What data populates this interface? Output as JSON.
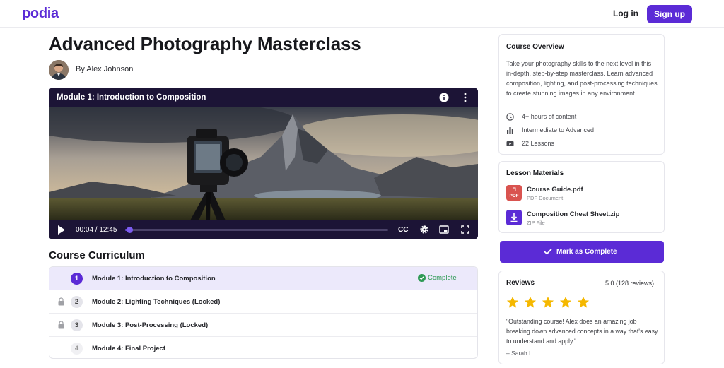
{
  "header": {
    "logo": "podia",
    "login": "Log in",
    "signup": "Sign up"
  },
  "course": {
    "title": "Advanced Photography Masterclass",
    "byline": "By Alex Johnson"
  },
  "player": {
    "title": "Module 1: Introduction to Composition",
    "time": "00:04 / 12:45",
    "progress_fraction": 0.005,
    "cc": "CC",
    "icons": [
      "info-icon",
      "more-vertical-icon",
      "play-icon",
      "captions-icon",
      "gear-icon",
      "picture-in-picture-icon",
      "fullscreen-icon"
    ]
  },
  "curriculum": {
    "title": "Course Curriculum",
    "modules": [
      {
        "num": "1",
        "label": "Module 1: Introduction to Composition",
        "status": "Complete"
      },
      {
        "num": "2",
        "label": "Module 2: Lighting Techniques (Locked)"
      },
      {
        "num": "3",
        "label": "Module 3: Post-Processing (Locked)"
      },
      {
        "num": "4",
        "label": "Module 4: Final Project"
      }
    ]
  },
  "overview": {
    "title": "Course Overview",
    "description": "Take your photography skills to the next level in this in-depth, step-by-step masterclass. Learn advanced composition, lighting, and post-processing techniques to create stunning images in any environment.",
    "meta": [
      {
        "icon": "clock-icon",
        "text": "4+ hours of content"
      },
      {
        "icon": "bar-chart-icon",
        "text": "Intermediate to Advanced"
      },
      {
        "icon": "video-icon",
        "text": "22 Lessons"
      }
    ]
  },
  "materials": {
    "title": "Lesson Materials",
    "files": [
      {
        "name": "Course Guide.pdf",
        "type": "PDF Document",
        "icon_label": "PDF",
        "color": "#d9534f"
      },
      {
        "name": "Composition Cheat Sheet.zip",
        "type": "ZIP File",
        "color": "#5b2bd6"
      }
    ]
  },
  "mark_complete": "Mark as Complete",
  "reviews": {
    "title": "Reviews",
    "score": "5.0 (128 reviews)",
    "rating": 5,
    "quote": "\"Outstanding course! Alex does an amazing job breaking down advanced concepts in a way that's easy to understand and apply.\"",
    "author": "– Sarah L."
  },
  "colors": {
    "brand": "#5b2bd6",
    "success": "#2f9a55",
    "star": "#f5b800"
  }
}
